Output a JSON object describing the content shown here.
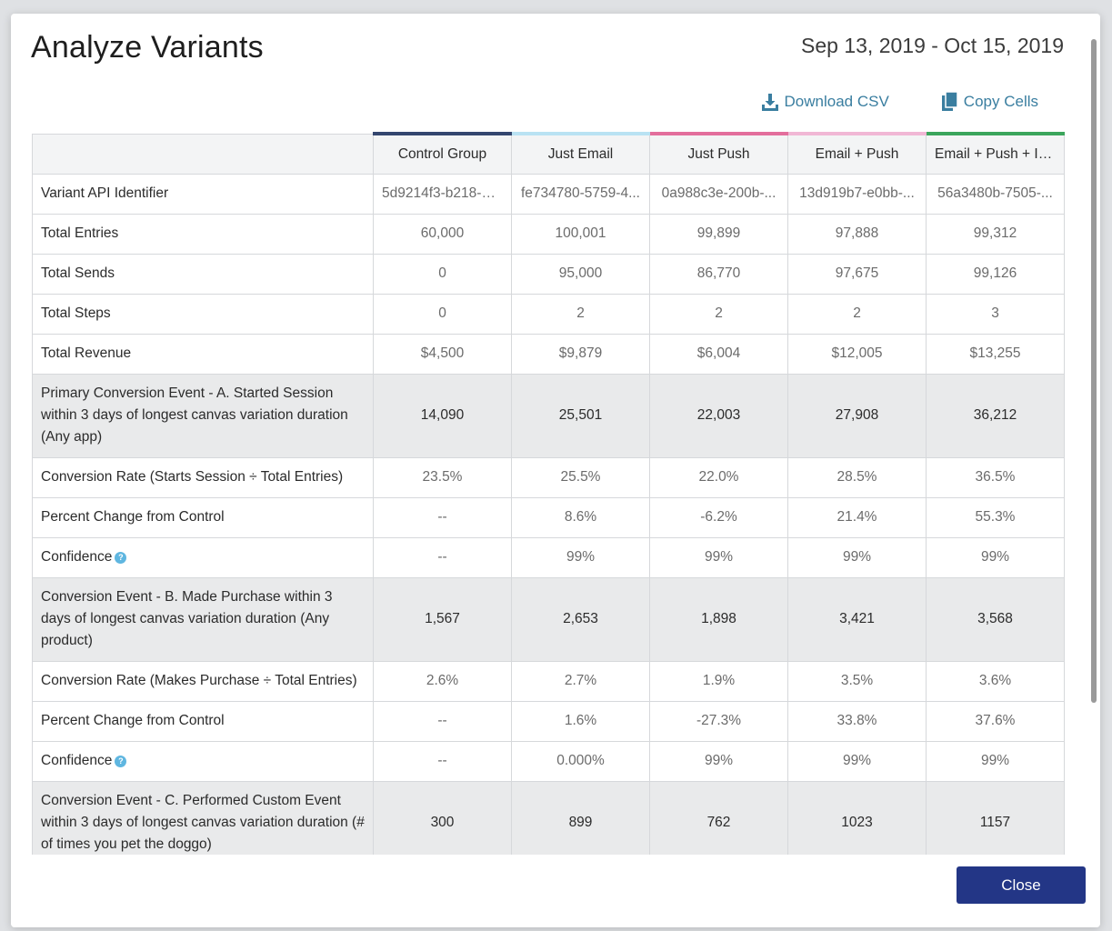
{
  "modal": {
    "title": "Analyze Variants",
    "date_range": "Sep 13, 2019 - Oct 15, 2019",
    "close_label": "Close"
  },
  "actions": {
    "download_csv": "Download CSV",
    "copy_cells": "Copy Cells"
  },
  "colors": {
    "accent_link": "#3a7ea0",
    "close_button": "#233686",
    "variant_colors": [
      "#34466f",
      "#b9e2f3",
      "#e36e9c",
      "#f1b7d5",
      "#3ba55c"
    ]
  },
  "table": {
    "columns": [
      "Control Group",
      "Just Email",
      "Just Push",
      "Email + Push",
      "Email + Push + IA..."
    ],
    "rows": [
      {
        "label": "Variant API Identifier",
        "values": [
          "5d9214f3-b218-4f...",
          "fe734780-5759-4...",
          "0a988c3e-200b-...",
          "13d919b7-e0bb-...",
          "56a3480b-7505-..."
        ]
      },
      {
        "label": "Total Entries",
        "values": [
          "60,000",
          "100,001",
          "99,899",
          "97,888",
          "99,312"
        ]
      },
      {
        "label": "Total Sends",
        "values": [
          "0",
          "95,000",
          "86,770",
          "97,675",
          "99,126"
        ]
      },
      {
        "label": "Total Steps",
        "values": [
          "0",
          "2",
          "2",
          "2",
          "3"
        ]
      },
      {
        "label": "Total Revenue",
        "values": [
          "$4,500",
          "$9,879",
          "$6,004",
          "$12,005",
          "$13,255"
        ]
      },
      {
        "label": "Primary Conversion Event - A. Started Session within 3 days of longest canvas variation duration (Any app)",
        "values": [
          "14,090",
          "25,501",
          "22,003",
          "27,908",
          "36,212"
        ]
      },
      {
        "label": "Conversion Rate (Starts Session ÷ Total Entries)",
        "values": [
          "23.5%",
          "25.5%",
          "22.0%",
          "28.5%",
          "36.5%"
        ]
      },
      {
        "label": "Percent Change from Control",
        "values": [
          "--",
          "8.6%",
          "-6.2%",
          "21.4%",
          "55.3%"
        ]
      },
      {
        "label": "Confidence",
        "values": [
          "--",
          "99%",
          "99%",
          "99%",
          "99%"
        ]
      },
      {
        "label": "Conversion Event - B. Made Purchase within 3 days of longest canvas variation duration (Any product)",
        "values": [
          "1,567",
          "2,653",
          "1,898",
          "3,421",
          "3,568"
        ]
      },
      {
        "label": "Conversion Rate (Makes Purchase ÷ Total Entries)",
        "values": [
          "2.6%",
          "2.7%",
          "1.9%",
          "3.5%",
          "3.6%"
        ]
      },
      {
        "label": "Percent Change from Control",
        "values": [
          "--",
          "1.6%",
          "-27.3%",
          "33.8%",
          "37.6%"
        ]
      },
      {
        "label": "Confidence",
        "values": [
          "--",
          "0.000%",
          "99%",
          "99%",
          "99%"
        ]
      },
      {
        "label": "Conversion Event - C. Performed Custom Event within 3 days of longest canvas variation duration (# of times you pet the doggo)",
        "values": [
          "300",
          "899",
          "762",
          "1023",
          "1157"
        ]
      }
    ]
  }
}
